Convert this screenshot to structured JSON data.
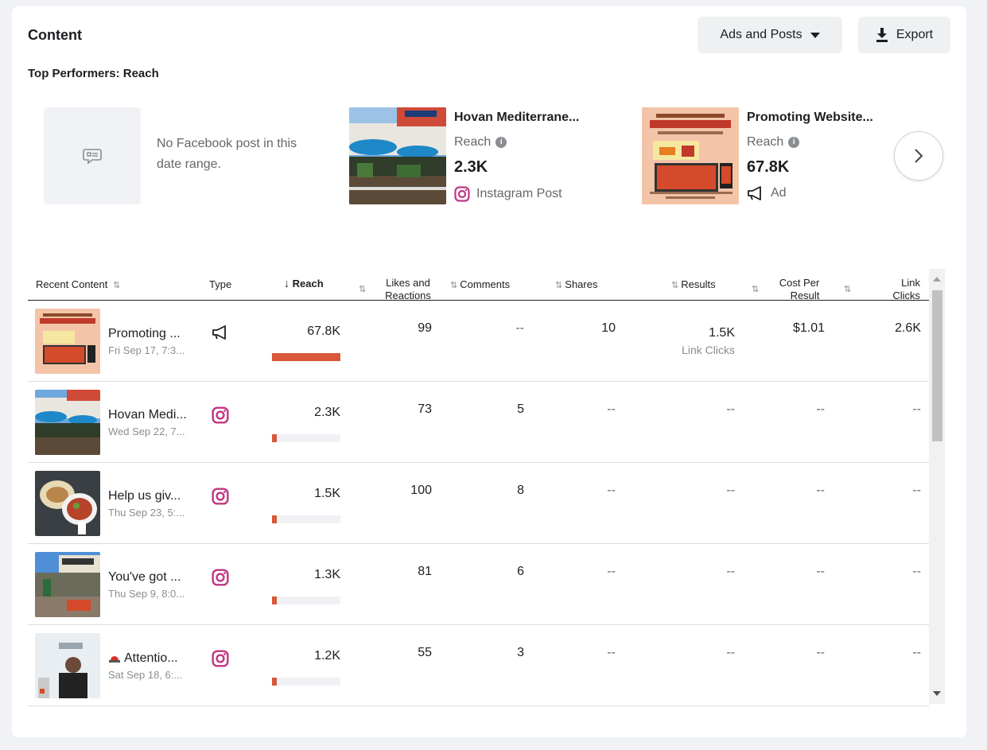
{
  "card": {
    "title": "Content",
    "subtitle": "Top Performers: Reach"
  },
  "toolbar": {
    "ads_posts_label": "Ads and Posts",
    "export_label": "Export"
  },
  "top_performers": {
    "empty_text": "No Facebook post in this date range.",
    "items": [
      {
        "title": "Hovan Mediterrane...",
        "metric_label": "Reach",
        "value": "2.3K",
        "type_label": "Instagram Post",
        "type_icon": "instagram-icon"
      },
      {
        "title": "Promoting Website...",
        "metric_label": "Reach",
        "value": "67.8K",
        "type_label": "Ad",
        "type_icon": "megaphone-icon"
      }
    ]
  },
  "table": {
    "headers": {
      "recent_content": "Recent Content",
      "type": "Type",
      "reach": "Reach",
      "likes_1": "Likes and",
      "likes_2": "Reactions",
      "comments": "Comments",
      "shares": "Shares",
      "results": "Results",
      "cost_1": "Cost Per",
      "cost_2": "Result",
      "link_1": "Link",
      "link_2": "Clicks"
    },
    "rows": [
      {
        "title": "Promoting ...",
        "date": "Fri Sep 17, 7:3...",
        "type_icon": "megaphone-icon",
        "reach": "67.8K",
        "reach_fraction": 1.0,
        "likes": "99",
        "comments": "--",
        "shares": "10",
        "results": "1.5K",
        "results_sub": "Link Clicks",
        "cost": "$1.01",
        "link_clicks": "2.6K"
      },
      {
        "title": "Hovan Medi...",
        "date": "Wed Sep 22, 7...",
        "type_icon": "instagram-icon",
        "reach": "2.3K",
        "reach_fraction": 0.034,
        "likes": "73",
        "comments": "5",
        "shares": "--",
        "results": "--",
        "results_sub": "",
        "cost": "--",
        "link_clicks": "--"
      },
      {
        "title": "Help us giv...",
        "date": "Thu Sep 23, 5:...",
        "type_icon": "instagram-icon",
        "reach": "1.5K",
        "reach_fraction": 0.022,
        "likes": "100",
        "comments": "8",
        "shares": "--",
        "results": "--",
        "results_sub": "",
        "cost": "--",
        "link_clicks": "--"
      },
      {
        "title": "You've got ...",
        "date": "Thu Sep 9, 8:0...",
        "type_icon": "instagram-icon",
        "reach": "1.3K",
        "reach_fraction": 0.019,
        "likes": "81",
        "comments": "6",
        "shares": "--",
        "results": "--",
        "results_sub": "",
        "cost": "--",
        "link_clicks": "--"
      },
      {
        "title": "Attentio...",
        "date": "Sat Sep 18, 6:...",
        "type_icon": "instagram-icon",
        "reach": "1.2K",
        "reach_fraction": 0.018,
        "likes": "55",
        "comments": "3",
        "shares": "--",
        "results": "--",
        "results_sub": "",
        "cost": "--",
        "link_clicks": "--"
      }
    ]
  },
  "colors": {
    "reach_bar": "#d9573a",
    "instagram": "#c13584"
  }
}
